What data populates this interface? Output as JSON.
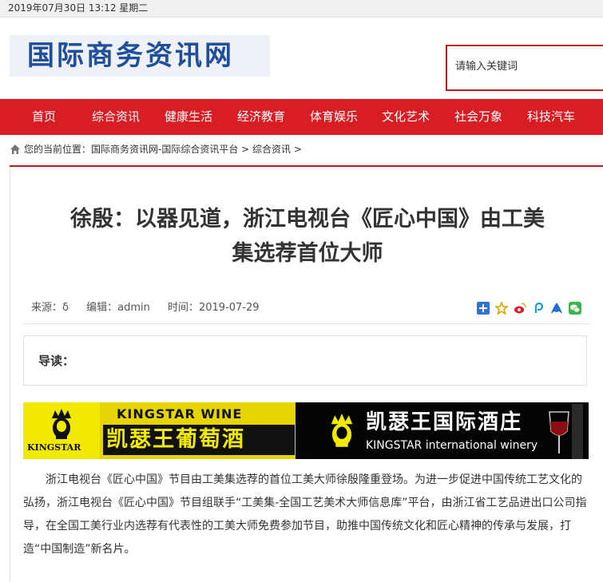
{
  "topbar": {
    "datetime": "2019年07月30日 13:12 星期二"
  },
  "header": {
    "logo_text": "国际商务资讯网",
    "search_placeholder": "请输入关键词"
  },
  "nav": {
    "items": [
      "首页",
      "综合资讯",
      "健康生活",
      "经济教育",
      "体育娱乐",
      "文化艺术",
      "社会万象",
      "科技汽车"
    ]
  },
  "breadcrumb": {
    "text": "您的当前位置：国际商务资讯网-国际综合资讯平台 > 综合资讯 >"
  },
  "article": {
    "title_line1": "徐殷：以器见道，浙江电视台《匠心中国》由工美",
    "title_line2": "集选荐首位大师",
    "source": "来源：δ",
    "editor": "编辑：admin",
    "time": "时间：2019-07-29",
    "share_icons": [
      "share-plus-icon",
      "star-icon",
      "weibo-icon",
      "paopao-icon",
      "qzone-icon",
      "wechat-icon"
    ],
    "summary_label": "导读：",
    "body": "浙江电视台《匠心中国》节目由工美集选荐的首位工美大师徐殷隆重登场。为进一步促进中国传统工艺文化的弘扬，浙江电视台《匠心中国》节目组联手“工美集-全国工艺美术大师信息库”平台，由浙江省工艺品进出口公司指导，在全国工美行业内选荐有代表性的工美大师免费参加节目，助推中国传统文化和匠心精神的传承与发展，打造“中国制造”新名片。"
  },
  "banner": {
    "brand": "KINGSTAR",
    "wine_en": "KINGSTAR WINE",
    "wine_cn": "凯瑟王葡萄酒",
    "right_cn": "凯瑟王国际酒庄",
    "right_en": "KINGSTAR international winery"
  },
  "colors": {
    "accent": "#d81e24",
    "logo_blue": "#1f4e9c",
    "banner_yellow": "#f2e900"
  }
}
